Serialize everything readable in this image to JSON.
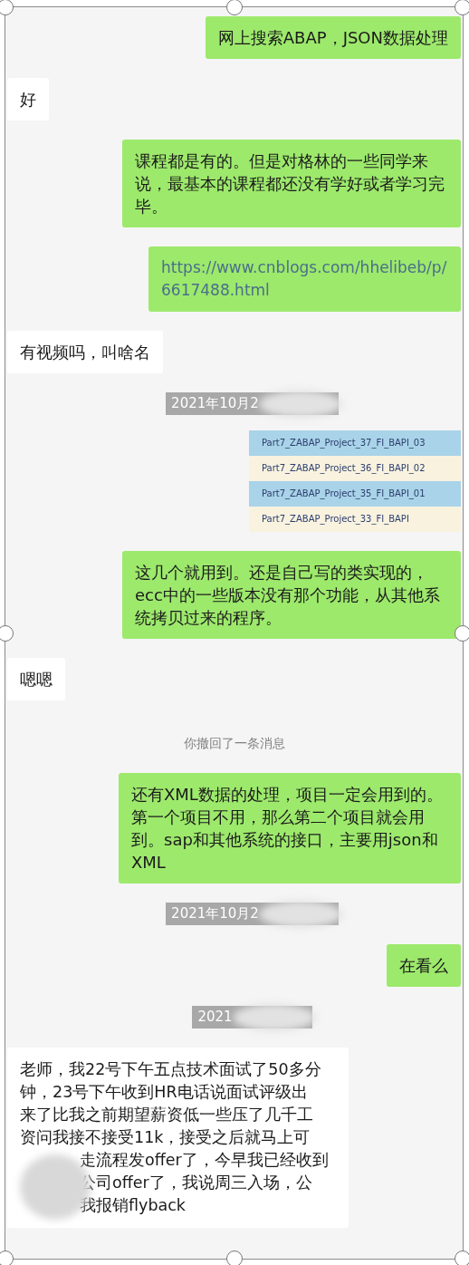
{
  "messages": [
    {
      "kind": "text",
      "outgoing": true,
      "text": "网上搜索ABAP，JSON数据处理"
    },
    {
      "kind": "text",
      "outgoing": false,
      "text": "好"
    },
    {
      "kind": "text",
      "outgoing": true,
      "text": "课程都是有的。但是对格林的一些同学来说，最基本的课程都还没有学好或者学习完毕。"
    },
    {
      "kind": "link",
      "outgoing": true,
      "text": "https://www.cnblogs.com/hhelibeb/p/6617488.html"
    },
    {
      "kind": "text",
      "outgoing": false,
      "text": "有视频吗，叫啥名"
    },
    {
      "kind": "date",
      "text": "2021年10月2",
      "redacted": true
    },
    {
      "kind": "image",
      "outgoing": true,
      "files": [
        {
          "name": "Part7_ZABAP_Project_37_FI_BAPI_03",
          "selected": true
        },
        {
          "name": "Part7_ZABAP_Project_36_FI_BAPI_02",
          "selected": false
        },
        {
          "name": "Part7_ZABAP_Project_35_FI_BAPI_01",
          "selected": true
        },
        {
          "name": "Part7_ZABAP_Project_33_FI_BAPI",
          "selected": false
        }
      ]
    },
    {
      "kind": "text",
      "outgoing": true,
      "text": "这几个就用到。还是自己写的类实现的，ecc中的一些版本没有那个功能，从其他系统拷贝过来的程序。"
    },
    {
      "kind": "text",
      "outgoing": false,
      "text": "嗯嗯"
    },
    {
      "kind": "system",
      "text": "你撤回了一条消息"
    },
    {
      "kind": "text",
      "outgoing": true,
      "text": "还有XML数据的处理，项目一定会用到的。第一个项目不用，那么第二个项目就会用到。sap和其他系统的接口，主要用json和XML"
    },
    {
      "kind": "date",
      "text": "2021年10月2",
      "redacted": true
    },
    {
      "kind": "text",
      "outgoing": true,
      "text": "在看么"
    },
    {
      "kind": "date",
      "text": "2021",
      "redacted": true
    },
    {
      "kind": "lines",
      "outgoing": false,
      "lines": [
        {
          "text": "老师，我22号下午五点技术面试了50多分",
          "masked": false
        },
        {
          "text": "钟，23号下午收到HR电话说面试评级出",
          "masked": false
        },
        {
          "text": "来了比我之前期望薪资低一些压了几千工",
          "masked": false
        },
        {
          "text": "资问我接不接受11k，接受之后就马上可",
          "masked": false
        },
        {
          "text": "走流程发offer了，今早我已经收到",
          "masked": true
        },
        {
          "text": "公司offer了，我说周三入场，公",
          "masked": true
        },
        {
          "text": "我报销flyback",
          "masked": true
        }
      ]
    }
  ]
}
